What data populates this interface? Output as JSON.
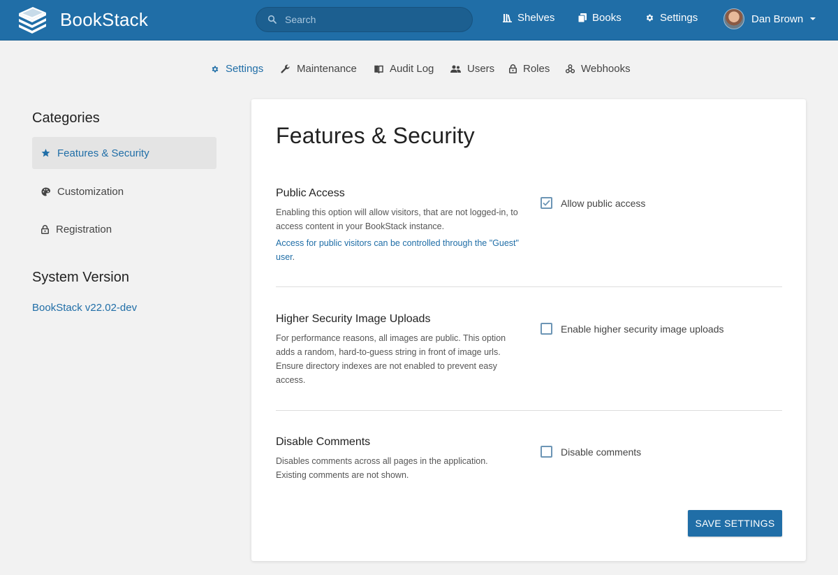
{
  "app": {
    "name": "BookStack"
  },
  "search": {
    "placeholder": "Search"
  },
  "topnav": [
    {
      "label": "Shelves",
      "icon": "shelves-icon"
    },
    {
      "label": "Books",
      "icon": "books-icon"
    },
    {
      "label": "Settings",
      "icon": "gear-icon"
    }
  ],
  "user": {
    "name": "Dan Brown"
  },
  "subnav": [
    {
      "label": "Settings",
      "icon": "gear-icon",
      "active": true
    },
    {
      "label": "Maintenance",
      "icon": "wrench-icon"
    },
    {
      "label": "Audit Log",
      "icon": "audit-log-icon"
    },
    {
      "label": "Users",
      "icon": "users-icon"
    },
    {
      "label": "Roles",
      "icon": "lock-icon"
    },
    {
      "label": "Webhooks",
      "icon": "webhooks-icon"
    }
  ],
  "sidebar": {
    "categories_title": "Categories",
    "items": [
      {
        "label": "Features & Security",
        "icon": "star-icon",
        "active": true
      },
      {
        "label": "Customization",
        "icon": "palette-icon"
      },
      {
        "label": "Registration",
        "icon": "lock-icon"
      }
    ],
    "version_title": "System Version",
    "version_link": "BookStack v22.02-dev"
  },
  "main": {
    "title": "Features & Security",
    "settings": [
      {
        "title": "Public Access",
        "description": "Enabling this option will allow visitors, that are not logged-in, to access content in your BookStack instance.",
        "link": "Access for public visitors can be controlled through the \"Guest\" user",
        "link_suffix": ".",
        "checkbox_label": "Allow public access",
        "checked": true
      },
      {
        "title": "Higher Security Image Uploads",
        "description": "For performance reasons, all images are public. This option adds a random, hard-to-guess string in front of image urls. Ensure directory indexes are not enabled to prevent easy access.",
        "checkbox_label": "Enable higher security image uploads",
        "checked": false
      },
      {
        "title": "Disable Comments",
        "description": "Disables comments across all pages in the application. Existing comments are not shown.",
        "checkbox_label": "Disable comments",
        "checked": false
      }
    ],
    "save_label": "Save Settings"
  },
  "colors": {
    "brand": "#206ea7",
    "background": "#f2f2f2"
  }
}
